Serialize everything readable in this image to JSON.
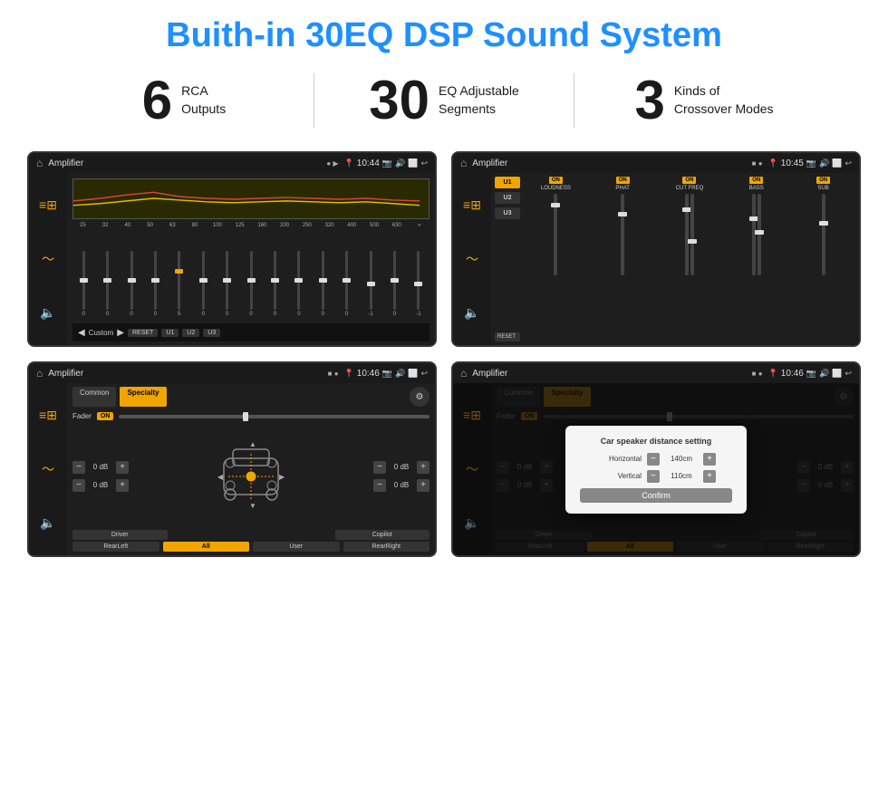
{
  "header": {
    "title": "Buith-in 30EQ DSP Sound System"
  },
  "stats": [
    {
      "number": "6",
      "text_line1": "RCA",
      "text_line2": "Outputs"
    },
    {
      "number": "30",
      "text_line1": "EQ Adjustable",
      "text_line2": "Segments"
    },
    {
      "number": "3",
      "text_line1": "Kinds of",
      "text_line2": "Crossover Modes"
    }
  ],
  "screens": [
    {
      "id": "eq-screen",
      "status_bar": {
        "title": "Amplifier",
        "time": "10:44"
      },
      "type": "eq"
    },
    {
      "id": "crossover-screen",
      "status_bar": {
        "title": "Amplifier",
        "time": "10:45"
      },
      "type": "crossover"
    },
    {
      "id": "specialty-screen",
      "status_bar": {
        "title": "Amplifier",
        "time": "10:46"
      },
      "type": "specialty"
    },
    {
      "id": "dialog-screen",
      "status_bar": {
        "title": "Amplifier",
        "time": "10:46"
      },
      "type": "dialog"
    }
  ],
  "eq": {
    "frequencies": [
      "25",
      "32",
      "40",
      "50",
      "63",
      "80",
      "100",
      "125",
      "160",
      "200",
      "250",
      "320",
      "400",
      "500",
      "630"
    ],
    "values": [
      "0",
      "0",
      "0",
      "0",
      "5",
      "0",
      "0",
      "0",
      "0",
      "0",
      "0",
      "0",
      "-1",
      "0",
      "-1"
    ],
    "preset_label": "Custom",
    "buttons": [
      "RESET",
      "U1",
      "U2",
      "U3"
    ]
  },
  "crossover": {
    "presets": [
      "U1",
      "U2",
      "U3"
    ],
    "channels": [
      "LOUDNESS",
      "PHAT",
      "CUT FREQ",
      "BASS",
      "SUB"
    ],
    "reset_label": "RESET"
  },
  "specialty": {
    "tabs": [
      "Common",
      "Specialty"
    ],
    "fader_label": "Fader",
    "fader_on": "ON",
    "db_values": [
      "0 dB",
      "0 dB",
      "0 dB",
      "0 dB"
    ],
    "buttons": [
      "Driver",
      "Copilot",
      "RearLeft",
      "All",
      "User",
      "RearRight"
    ]
  },
  "dialog": {
    "title": "Car speaker distance setting",
    "horizontal_label": "Horizontal",
    "horizontal_value": "140cm",
    "vertical_label": "Vertical",
    "vertical_value": "110cm",
    "confirm_label": "Confirm",
    "tabs": [
      "Common",
      "Specialty"
    ],
    "buttons": [
      "Driver",
      "Copilot",
      "RearLeft",
      "All",
      "User",
      "RearRight"
    ]
  },
  "colors": {
    "accent": "#f0a500",
    "brand_blue": "#1e90ff",
    "dark_bg": "#1a1a1a",
    "text_dark": "#1a1a1a"
  }
}
